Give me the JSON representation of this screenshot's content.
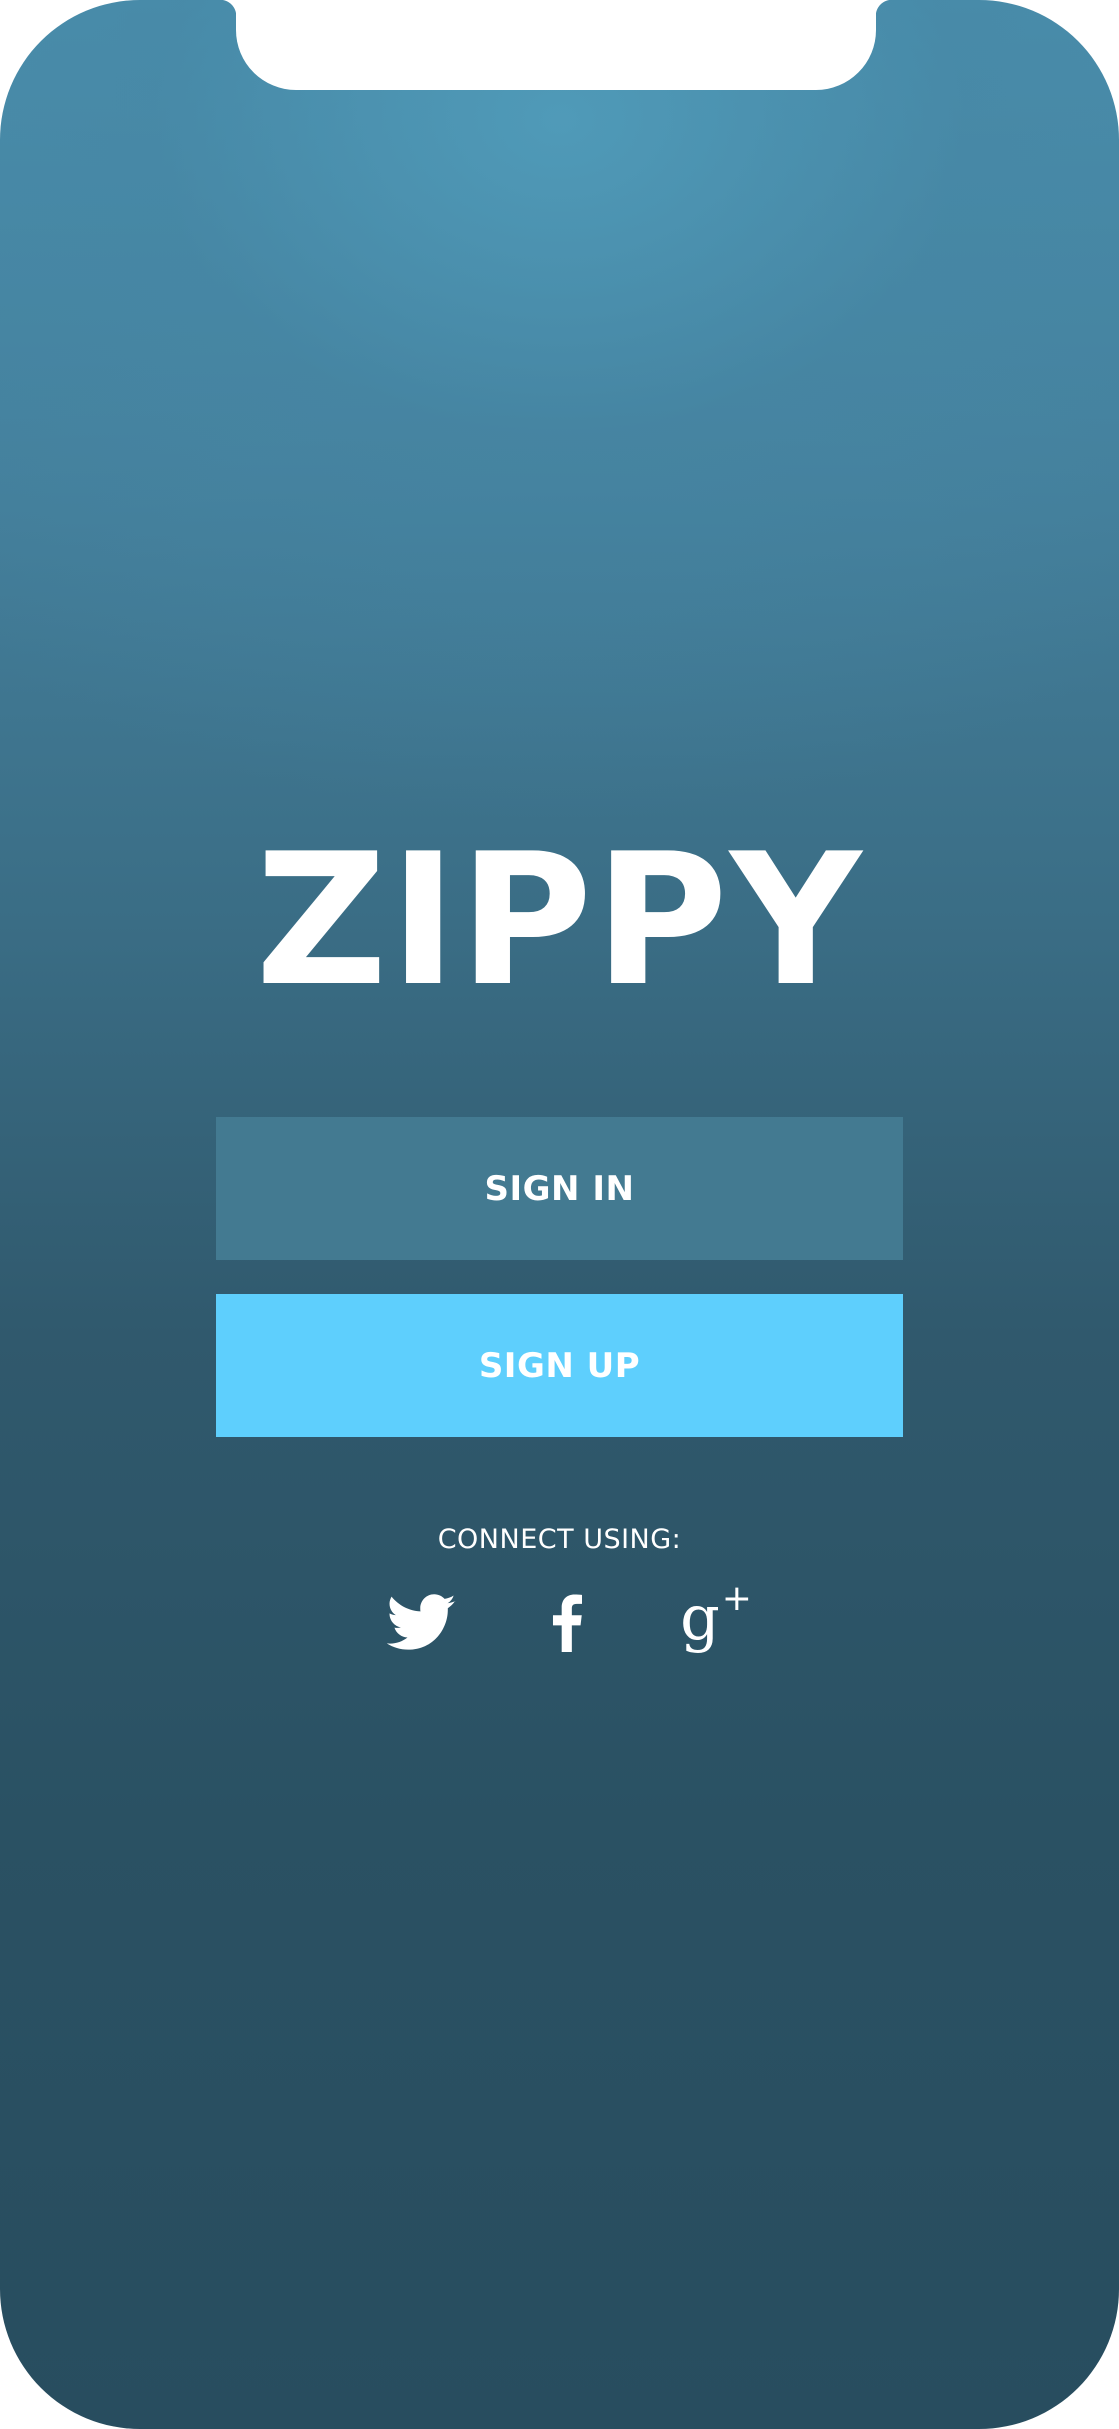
{
  "app": {
    "logo": "ZIPPY"
  },
  "auth": {
    "sign_in_label": "SIGN IN",
    "sign_up_label": "SIGN UP"
  },
  "social": {
    "connect_label": "CONNECT USING:",
    "providers": [
      {
        "name": "twitter",
        "icon": "twitter-icon"
      },
      {
        "name": "facebook",
        "icon": "facebook-icon"
      },
      {
        "name": "google-plus",
        "icon": "google-plus-icon",
        "glyph": "g",
        "plus": "+"
      }
    ]
  },
  "colors": {
    "sign_in_bg": "#437a91",
    "sign_up_bg": "#5ecffd",
    "background_top": "#4a8fad",
    "background_bottom": "#284d5f",
    "text": "#ffffff"
  }
}
